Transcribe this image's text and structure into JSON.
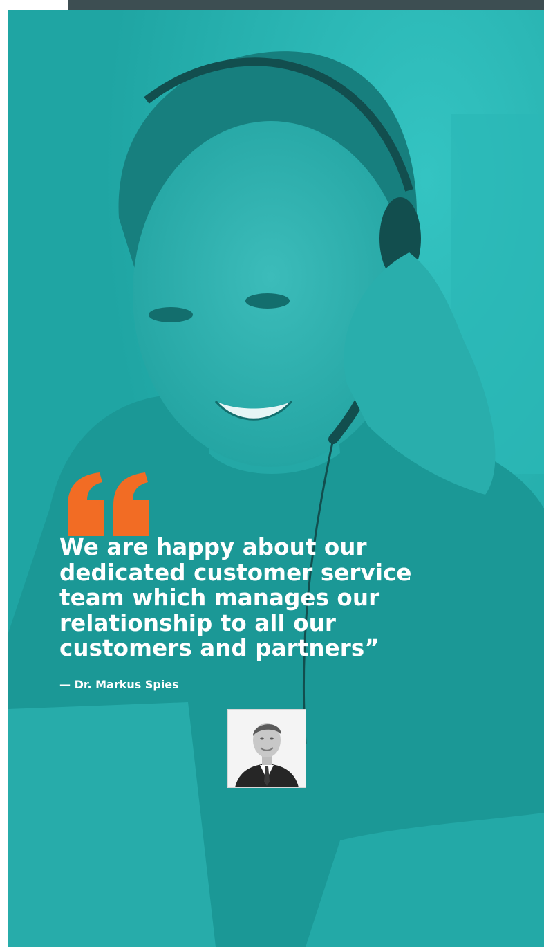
{
  "quote": {
    "lines": [
      "We are happy about our",
      "dedicated customer service",
      "team which manages our",
      "relationship to all our",
      "customers and partners”"
    ]
  },
  "author": {
    "attribution": "— Dr. Markus Spies"
  },
  "icons": {
    "quote_mark": "opening-quote-icon"
  },
  "colors": {
    "teal_overlay": "#1fa5a3",
    "accent_orange": "#f26c24",
    "top_bar": "#3d4e52",
    "text": "#ffffff"
  }
}
